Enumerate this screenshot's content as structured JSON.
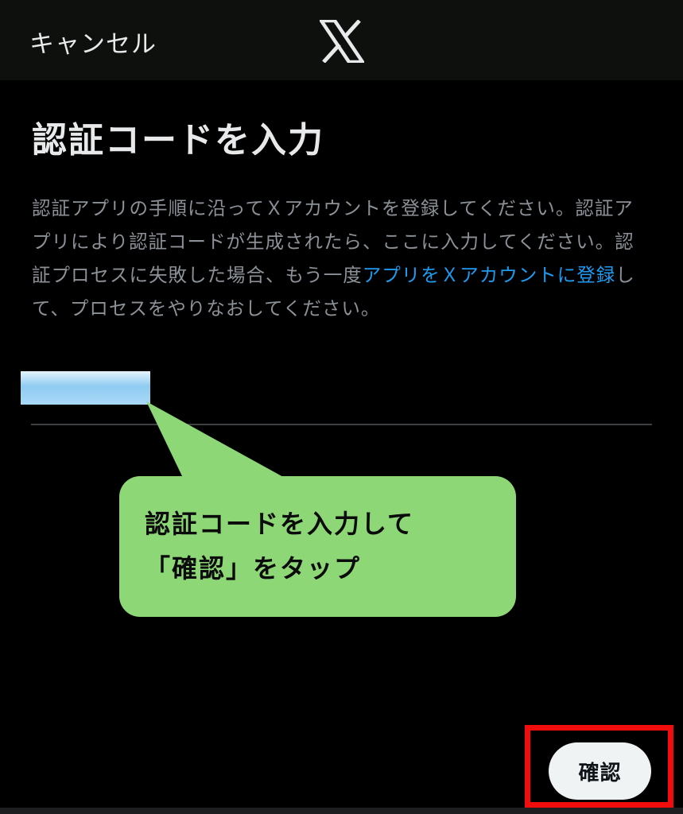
{
  "header": {
    "cancel_label": "キャンセル",
    "logo_icon": "x-logo-icon"
  },
  "main": {
    "title": "認証コードを入力",
    "description_part1": "認証アプリの手順に沿ってＸアカウントを登録してください。認証アプリにより認証コードが生成されたら、ここに入力してください。認証プロセスに失敗した場合、もう一度",
    "description_link": "アプリをＸアカウントに登録",
    "description_part2": "して、プロセスをやりなおしてください。",
    "code_input_value": "",
    "confirm_label": "確認"
  },
  "annotation": {
    "line1": "認証コードを入力して",
    "line2": "「確認」をタップ"
  },
  "colors": {
    "background": "#000000",
    "header_bg": "#0d100d",
    "text_primary": "#e7e9ea",
    "text_secondary": "#8b9197",
    "link": "#1d9bf0",
    "callout_bg": "#8ed777",
    "highlight_frame": "#f20d0d",
    "button_bg": "#eff3f4"
  }
}
